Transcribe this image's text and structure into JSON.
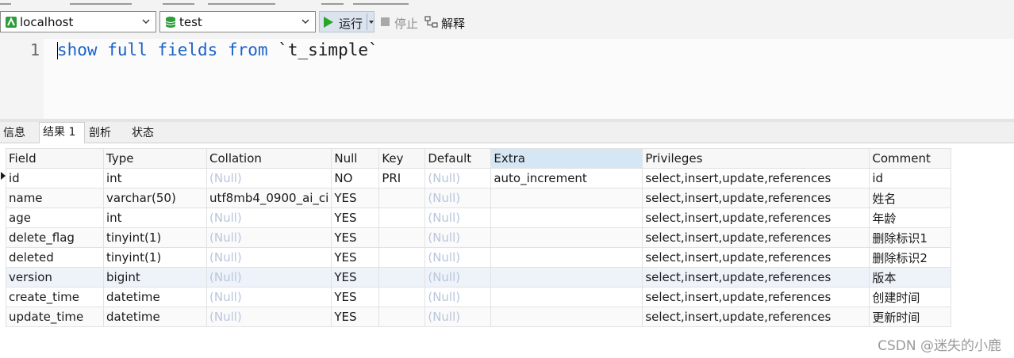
{
  "toolbar": {
    "connection": "localhost",
    "database": "test",
    "run_label": "运行",
    "stop_label": "停止",
    "explain_label": "解释"
  },
  "editor": {
    "line_number": "1",
    "tokens": [
      {
        "text": "show",
        "kw": true
      },
      {
        "text": " ",
        "kw": false
      },
      {
        "text": "full",
        "kw": true
      },
      {
        "text": " ",
        "kw": false
      },
      {
        "text": "fields",
        "kw": true
      },
      {
        "text": " ",
        "kw": false
      },
      {
        "text": "from",
        "kw": true
      },
      {
        "text": " `t_simple`",
        "kw": false
      }
    ]
  },
  "tabs": [
    {
      "label": "信息",
      "active": false
    },
    {
      "label": "结果 1",
      "active": true
    },
    {
      "label": "剖析",
      "active": false
    },
    {
      "label": "状态",
      "active": false
    }
  ],
  "grid": {
    "columns": [
      "Field",
      "Type",
      "Collation",
      "Null",
      "Key",
      "Default",
      "Extra",
      "Privileges",
      "Comment"
    ],
    "selected_column": "Extra",
    "rows": [
      [
        "id",
        "int",
        "(Null)",
        "NO",
        "PRI",
        "(Null)",
        "auto_increment",
        "select,insert,update,references",
        "id"
      ],
      [
        "name",
        "varchar(50)",
        "utf8mb4_0900_ai_ci",
        "YES",
        "",
        "(Null)",
        "",
        "select,insert,update,references",
        "姓名"
      ],
      [
        "age",
        "int",
        "(Null)",
        "YES",
        "",
        "(Null)",
        "",
        "select,insert,update,references",
        "年龄"
      ],
      [
        "delete_flag",
        "tinyint(1)",
        "(Null)",
        "YES",
        "",
        "(Null)",
        "",
        "select,insert,update,references",
        "删除标识1"
      ],
      [
        "deleted",
        "tinyint(1)",
        "(Null)",
        "YES",
        "",
        "(Null)",
        "",
        "select,insert,update,references",
        "删除标识2"
      ],
      [
        "version",
        "bigint",
        "(Null)",
        "YES",
        "",
        "(Null)",
        "",
        "select,insert,update,references",
        "版本"
      ],
      [
        "create_time",
        "datetime",
        "(Null)",
        "YES",
        "",
        "(Null)",
        "",
        "select,insert,update,references",
        "创建时间"
      ],
      [
        "update_time",
        "datetime",
        "(Null)",
        "YES",
        "",
        "(Null)",
        "",
        "select,insert,update,references",
        "更新时间"
      ]
    ],
    "null_text": "(Null)"
  },
  "watermark": "CSDN @迷失的小鹿"
}
